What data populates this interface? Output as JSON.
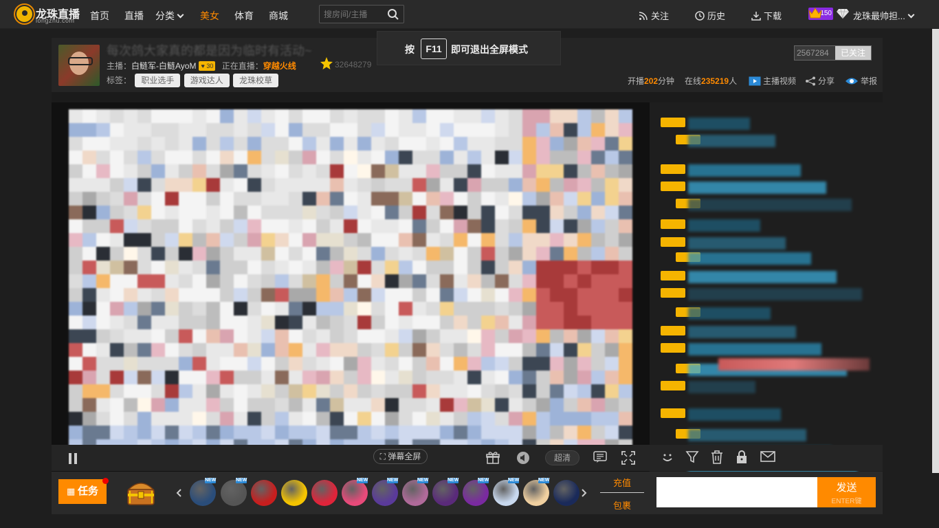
{
  "nav": {
    "logo_text": "龙珠直播",
    "logo_sub": "longzhu.com",
    "items": [
      "首页",
      "直播",
      "分类",
      "美女",
      "体育",
      "商城"
    ],
    "search_placeholder": "搜房间/主播",
    "follow": "关注",
    "history": "历史",
    "download": "下载",
    "vip_level": "150",
    "username": "龙珠最帅担..."
  },
  "toast": {
    "pre": "按",
    "key": "F11",
    "post": "即可退出全屏模式"
  },
  "room": {
    "title": "每次鸽大家真的都是因为临时有活动~",
    "host_label": "主播：",
    "host_name": "白鲢军-白鲢AyoM",
    "host_level": "30",
    "live_label": "正在直播：",
    "game": "穿越火线",
    "room_id": "32648279",
    "tags_label": "标签：",
    "tags": [
      "职业选手",
      "游戏达人",
      "龙珠校草"
    ],
    "follow_count": "2567284",
    "follow_status": "已关注",
    "live_minutes_pre": "开播",
    "live_minutes": "202",
    "live_minutes_post": "分钟",
    "online_pre": "在线",
    "online_count": "235219",
    "online_post": "人",
    "host_video": "主播视频",
    "share": "分享",
    "report": "举报"
  },
  "player": {
    "danmu_full": "弹幕全屏",
    "quality": "超清"
  },
  "gift_bar": {
    "task": "任务",
    "charge": "充值",
    "bag": "包裹",
    "new_label": "NEW",
    "send": "发送",
    "send_hint": "ENTER键"
  },
  "colors": {
    "accent": "#ff8a00",
    "bg": "#1e1e1e"
  }
}
